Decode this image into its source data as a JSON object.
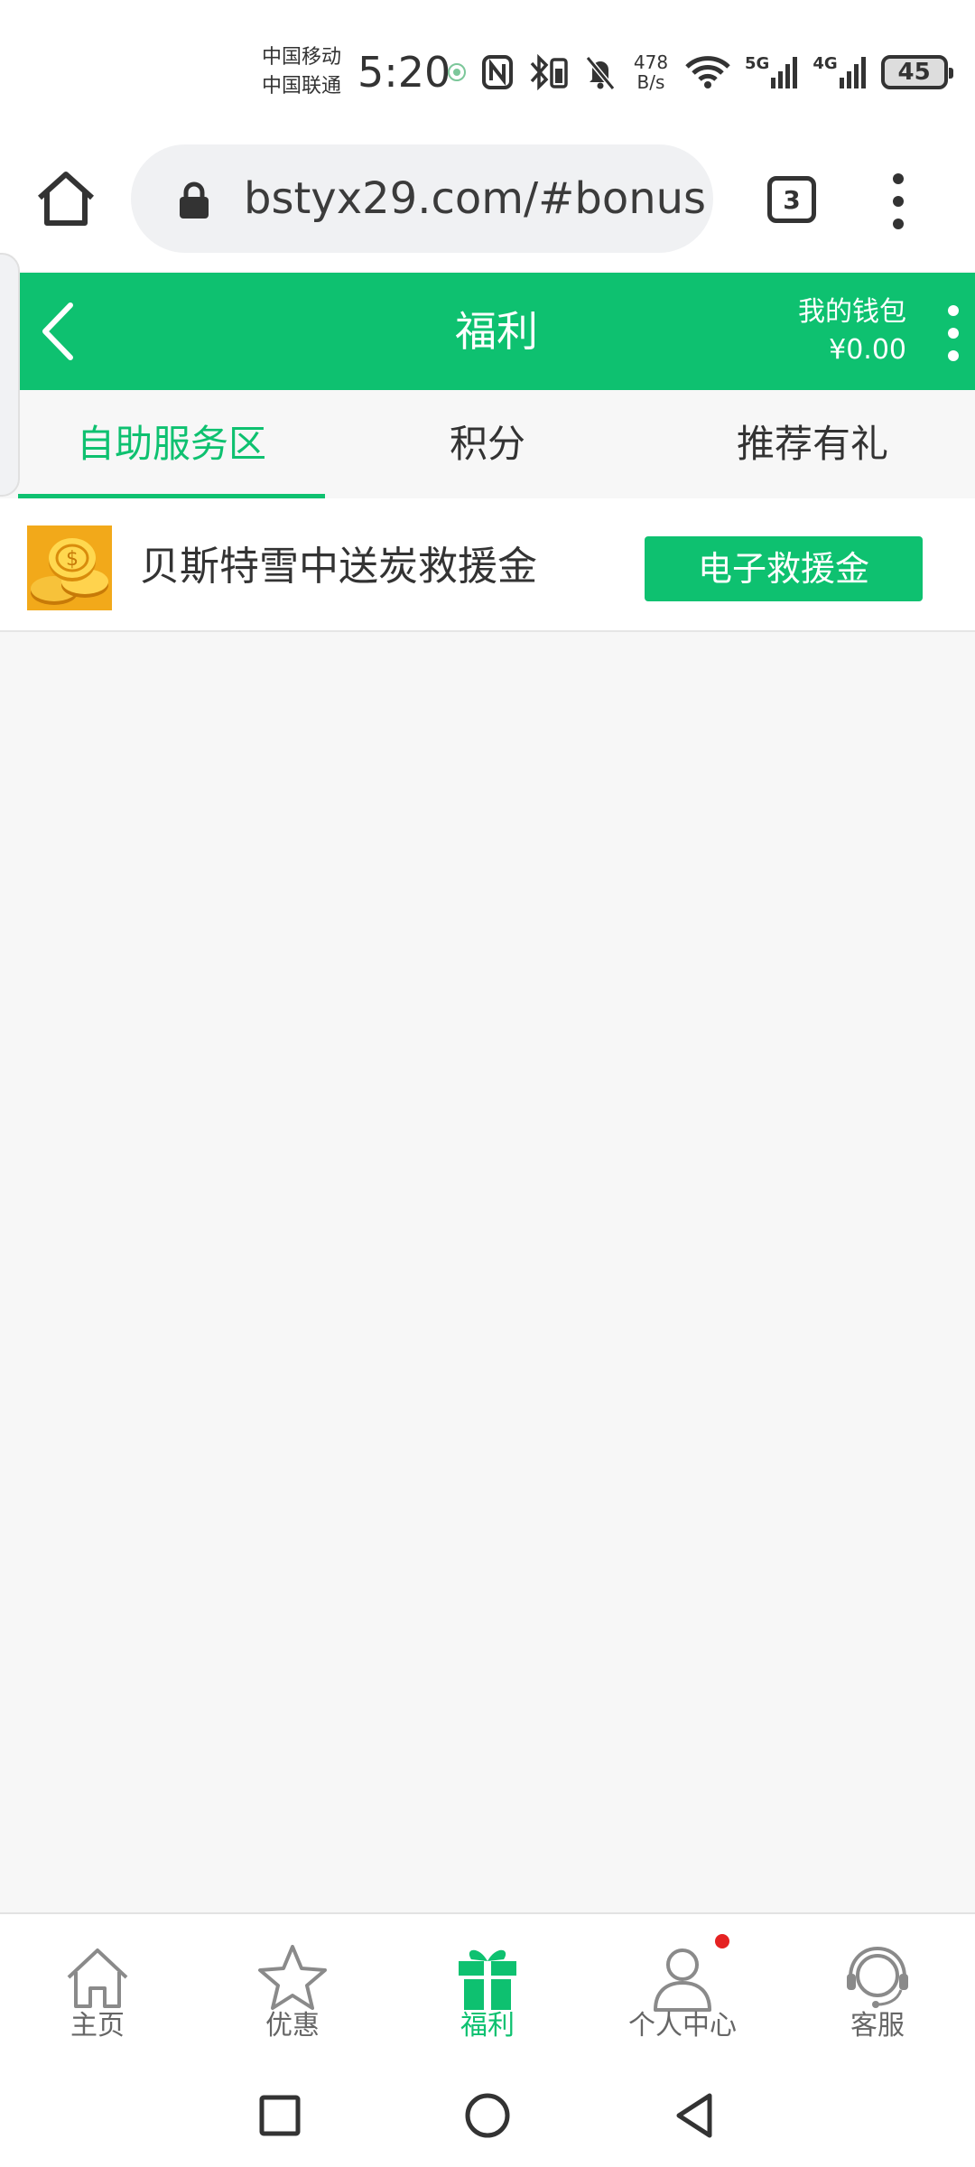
{
  "status_bar": {
    "carrier_1": "中国移动",
    "carrier_2": "中国联通",
    "time": "5:20",
    "net_speed_value": "478",
    "net_speed_unit": "B/s",
    "signal_1": "5G",
    "signal_2": "4G",
    "battery": "45"
  },
  "browser": {
    "url": "bstyx29.com/#bonus",
    "tab_count": "3"
  },
  "header": {
    "title": "福利",
    "wallet_label": "我的钱包",
    "wallet_amount": "¥0.00"
  },
  "tabs": [
    {
      "label": "自助服务区",
      "active": true
    },
    {
      "label": "积分",
      "active": false
    },
    {
      "label": "推荐有礼",
      "active": false
    }
  ],
  "bonus_items": [
    {
      "title": "贝斯特雪中送炭救援金",
      "button": "电子救援金",
      "icon": "gold-coins-icon"
    }
  ],
  "bottom_nav": [
    {
      "label": "主页",
      "icon": "home-icon",
      "active": false
    },
    {
      "label": "优惠",
      "icon": "star-icon",
      "active": false
    },
    {
      "label": "福利",
      "icon": "gift-icon",
      "active": true
    },
    {
      "label": "个人中心",
      "icon": "user-icon",
      "active": false
    },
    {
      "label": "客服",
      "icon": "headset-icon",
      "active": false
    }
  ],
  "colors": {
    "accent": "#0ec170",
    "notify": "#e52222"
  }
}
